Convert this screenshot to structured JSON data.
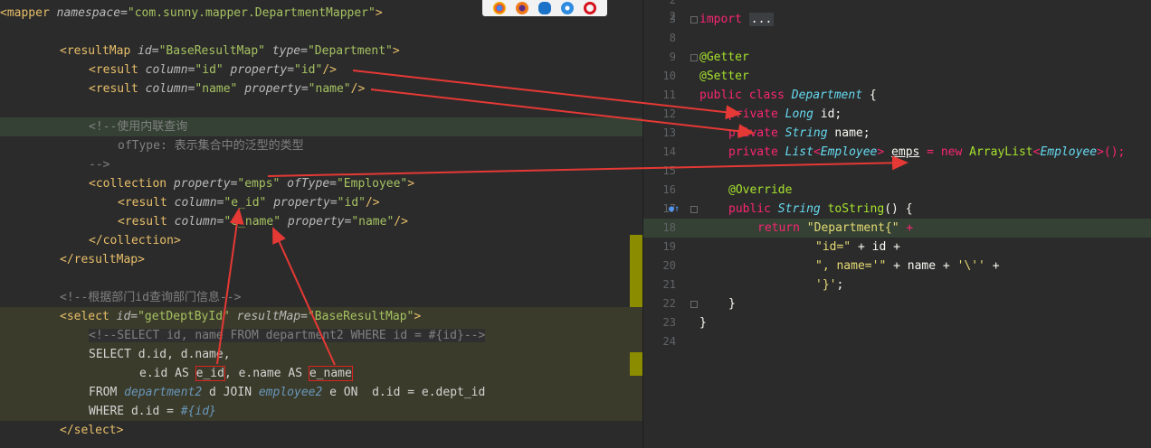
{
  "browser_bar": {
    "icons": [
      "chrome-icon",
      "firefox-icon",
      "edge-icon",
      "safari-icon",
      "opera-icon"
    ],
    "colors": [
      "#e0452b",
      "#f07a1a",
      "#1a73c9",
      "#2e8ce0",
      "#d6121c"
    ]
  },
  "left_editor": {
    "lines": {
      "l1": {
        "a": "<",
        "b": "mapper",
        "c": " namespace",
        "d": "=",
        "e": "\"com.sunny.mapper.DepartmentMapper\"",
        "f": ">"
      },
      "l3": {
        "a": "<",
        "b": "resultMap",
        "c": " id",
        "d": "=",
        "e": "\"BaseResultMap\"",
        "g": " type",
        "h": "=",
        "i": "\"Department\"",
        "f": ">"
      },
      "l4": {
        "a": "<",
        "b": "result",
        "c": " column",
        "d": "=",
        "e": "\"id\"",
        "g": " property",
        "h": "=",
        "i": "\"id\"",
        "f": "/>"
      },
      "l5": {
        "a": "<",
        "b": "result",
        "c": " column",
        "d": "=",
        "e": "\"name\"",
        "g": " property",
        "h": "=",
        "i": "\"name\"",
        "f": "/>"
      },
      "l7": {
        "text": "<!--使用内联查询"
      },
      "l8": {
        "text": "ofType: 表示集合中的泛型的类型"
      },
      "l9": {
        "text": "-->"
      },
      "l10": {
        "a": "<",
        "b": "collection",
        "c": " property",
        "d": "=",
        "e": "\"emps\"",
        "g": " ofType",
        "h": "=",
        "i": "\"Employee\"",
        "f": ">"
      },
      "l11": {
        "a": "<",
        "b": "result",
        "c": " column",
        "d": "=",
        "e": "\"e_id\"",
        "g": " property",
        "h": "=",
        "i": "\"id\"",
        "f": "/>"
      },
      "l12": {
        "a": "<",
        "b": "result",
        "c": " column",
        "d": "=",
        "e": "\"e_name\"",
        "g": " property",
        "h": "=",
        "i": "\"name\"",
        "f": "/>"
      },
      "l13": {
        "a": "</",
        "b": "collection",
        "f": ">"
      },
      "l14": {
        "a": "</",
        "b": "resultMap",
        "f": ">"
      },
      "l16": {
        "text": "<!--根据部门id查询部门信息-->"
      },
      "l17": {
        "a": "<",
        "b": "select",
        "c": " id",
        "d": "=",
        "e": "\"getDeptById\"",
        "g": " resultMap",
        "h": "=",
        "i": "\"BaseResultMap\"",
        "f": ">"
      },
      "l18": {
        "text": "<!--SELECT id, name FROM department2 WHERE id = #{id}-->"
      },
      "l19": {
        "text": "SELECT d.id, d.name,"
      },
      "l20": {
        "a": "e.id AS ",
        "b": "e_id",
        "c": ", e.name AS ",
        "d": "e_name"
      },
      "l21": {
        "a": "FROM ",
        "b": "department2",
        "c": " d JOIN ",
        "d": "employee2",
        "e": " e ON  d.id = e.dept_id"
      },
      "l22": {
        "a": "WHERE d.id = ",
        "b": "#{id}"
      },
      "l23": {
        "a": "</",
        "b": "select",
        "f": ">"
      }
    }
  },
  "right_editor": {
    "line_numbers": [
      "2",
      "3",
      "8",
      "9",
      "10",
      "11",
      "12",
      "13",
      "14",
      "15",
      "16",
      "17",
      "18",
      "19",
      "20",
      "21",
      "22",
      "23",
      "24"
    ],
    "import_kw": "import",
    "import_dots": "...",
    "getter": "@Getter",
    "setter": "@Setter",
    "class_decl": {
      "a": "public class ",
      "b": "Department",
      "c": " {"
    },
    "field_id": {
      "a": "private ",
      "b": "Long",
      "c": " id;"
    },
    "field_name": {
      "a": "private ",
      "b": "String",
      "c": " name;"
    },
    "field_emps": {
      "a": "private ",
      "b": "List",
      "c": "<",
      "d": "Employee",
      "e": "> ",
      "f": "emps",
      "g": " = ",
      "h": "new ",
      "i": "ArrayList",
      "j": "<",
      "k": "Employee",
      "l": ">();"
    },
    "override": "@Override",
    "tostring_decl": {
      "a": "public ",
      "b": "String",
      "c": " ",
      "d": "toString",
      "e": "() {"
    },
    "ret1": {
      "a": "return ",
      "b": "\"Department{\"",
      "c": " +"
    },
    "ret2": {
      "a": "\"id=\"",
      "b": " + id +"
    },
    "ret3": {
      "a": "\", name='\"",
      "b": " + name + ",
      "c": "'\\''",
      "d": " +"
    },
    "ret4": {
      "a": "'}'",
      "b": ";"
    },
    "close1": "}",
    "close2": "}"
  }
}
